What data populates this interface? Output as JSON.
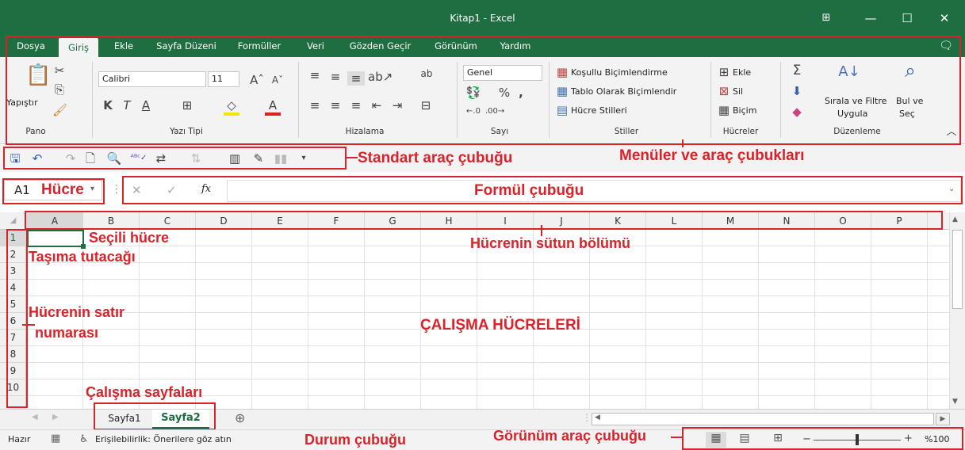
{
  "window": {
    "title": "Kitap1  -  Excel",
    "ribbon_display_icon": "ribbon-display-icon",
    "minimize": "—",
    "maximize": "☐",
    "close": "✕"
  },
  "tabs": [
    {
      "label": "Dosya"
    },
    {
      "label": "Giriş"
    },
    {
      "label": "Ekle"
    },
    {
      "label": "Sayfa Düzeni"
    },
    {
      "label": "Formüller"
    },
    {
      "label": "Veri"
    },
    {
      "label": "Gözden Geçir"
    },
    {
      "label": "Görünüm"
    },
    {
      "label": "Yardım"
    }
  ],
  "ribbon": {
    "pano": {
      "paste": "Yapıştır",
      "label": "Pano"
    },
    "font": {
      "name": "Calibri",
      "size": "11",
      "bold": "K",
      "italic": "T",
      "underline": "A",
      "label": "Yazı Tipi"
    },
    "alignment": {
      "label": "Hizalama"
    },
    "number": {
      "format": "Genel",
      "percent": "%",
      "comma": ",",
      "label": "Sayı"
    },
    "styles": {
      "conditional": "Koşullu Biçimlendirme",
      "table": "Tablo Olarak Biçimlendir",
      "cell": "Hücre Stilleri",
      "label": "Stiller"
    },
    "cells": {
      "insert": "Ekle",
      "delete": "Sil",
      "format": "Biçim",
      "label": "Hücreler"
    },
    "editing": {
      "sort1": "Sırala ve Filtre",
      "sort2": "Uygula",
      "find1": "Bul ve",
      "find2": "Seç",
      "label": "Düzenleme"
    }
  },
  "formula": {
    "namebox_ref": "A1",
    "namebox_label": "Hücre",
    "fx": "fx",
    "cancel": "✕",
    "confirm": "✓",
    "value": ""
  },
  "columns": [
    "A",
    "B",
    "C",
    "D",
    "E",
    "F",
    "G",
    "H",
    "I",
    "J",
    "K",
    "L",
    "M",
    "N",
    "O",
    "P"
  ],
  "rows": [
    "1",
    "2",
    "3",
    "4",
    "5",
    "6",
    "7",
    "8",
    "9",
    "10"
  ],
  "sheets": [
    {
      "name": "Sayfa1",
      "active": false
    },
    {
      "name": "Sayfa2",
      "active": true
    }
  ],
  "status": {
    "ready": "Hazır",
    "accessibility": "Erişilebilirlik: Önerilere göz atın",
    "zoom": "%100",
    "zoom_level": 0.5
  },
  "annotations": {
    "standart": "Standart araç çubuğu",
    "menuler": "Menüler ve araç çubukları",
    "formul": "Formül çubuğu",
    "secili": "Seçili hücre",
    "tasima": "Taşıma tutacağı",
    "sutun": "Hücrenin sütun bölümü",
    "satir1": "Hücrenin satır",
    "satir2": "numarası",
    "calisma": "ÇALIŞMA HÜCRELERİ",
    "sayfalar": "Çalışma sayfaları",
    "durum": "Durum çubuğu",
    "gorunum": "Görünüm araç çubuğu"
  },
  "colors": {
    "brand": "#1e6e42",
    "annotation": "#d9222a",
    "active_sheet": "#1e6e42"
  }
}
